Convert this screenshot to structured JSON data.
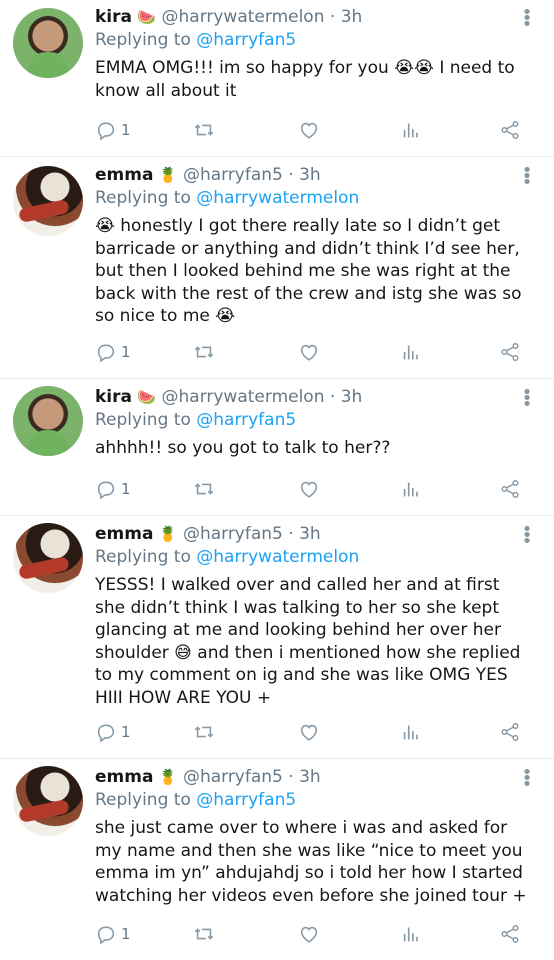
{
  "tweets": [
    {
      "avatar": "kira",
      "name": "kira",
      "name_emoji": "🍉",
      "handle": "@harrywatermelon",
      "time": "· 3h",
      "replying_label": "Replying to",
      "replying_to": "@harryfan5",
      "text": "EMMA OMG!!! im so happy for you 😭😭 I need to know all about it",
      "reply_count": "1"
    },
    {
      "avatar": "emma",
      "name": "emma",
      "name_emoji": "🍍",
      "handle": "@harryfan5",
      "time": "· 3h",
      "replying_label": "Replying to",
      "replying_to": "@harrywatermelon",
      "text": "😭 honestly I got there really late so I didn’t get barricade or anything and didn’t think I’d see her, but then I looked behind me she was right at the back with the rest of the crew and istg she was so so nice to me 😭",
      "reply_count": "1"
    },
    {
      "avatar": "kira",
      "name": "kira",
      "name_emoji": "🍉",
      "handle": "@harrywatermelon",
      "time": "· 3h",
      "replying_label": "Replying to",
      "replying_to": "@harryfan5",
      "text": "ahhhh!! so you got to talk to her??",
      "reply_count": "1"
    },
    {
      "avatar": "emma",
      "name": "emma",
      "name_emoji": "🍍",
      "handle": "@harryfan5",
      "time": "· 3h",
      "replying_label": "Replying to",
      "replying_to": "@harrywatermelon",
      "text": "YESSS! I walked over and called her and at first she didn’t think I was talking to her so she kept glancing at me and looking behind her over her shoulder 😅 and then i mentioned how she replied to my comment on ig and she was like OMG YES HIII HOW ARE YOU +",
      "reply_count": "1"
    },
    {
      "avatar": "emma",
      "name": "emma",
      "name_emoji": "🍍",
      "handle": "@harryfan5",
      "time": "· 3h",
      "replying_label": "Replying to",
      "replying_to": "@harryfan5",
      "text": "she just came over to where i was and asked for my name and then she was like “nice to meet you emma im yn” ahdujahdj so i told her how I started watching her videos even before she joined tour +",
      "reply_count": "1"
    }
  ],
  "icons": {
    "reply": "reply-icon",
    "retweet": "retweet-icon",
    "like": "heart-icon",
    "stats": "stats-icon",
    "share": "share-icon",
    "menu": "more-vertical-icon"
  }
}
